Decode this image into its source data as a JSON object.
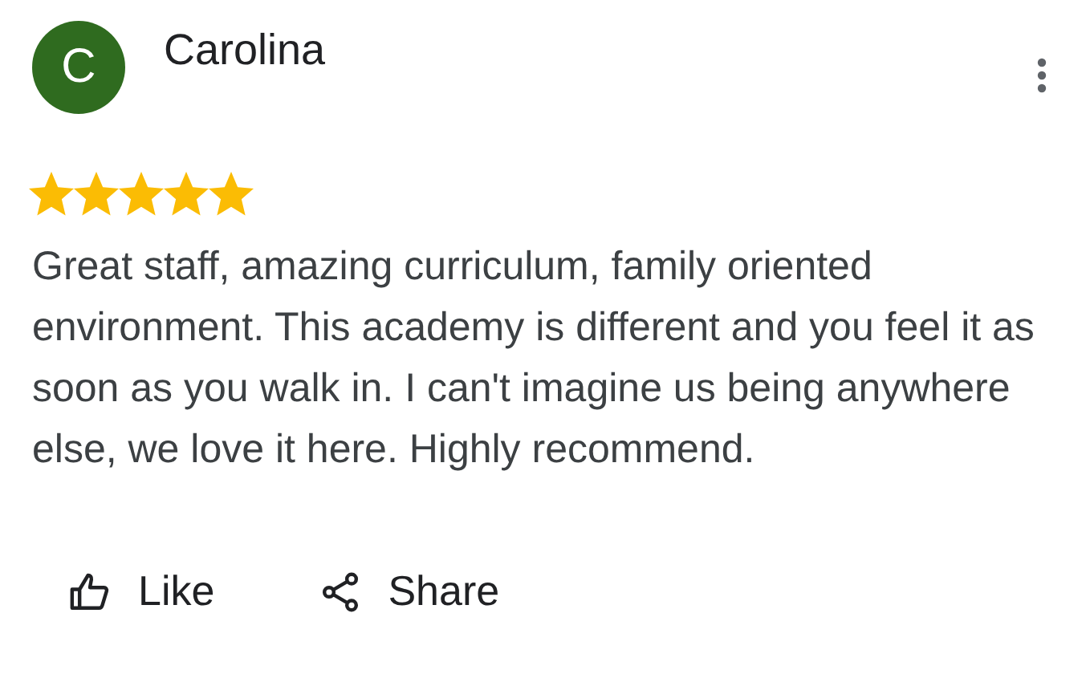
{
  "review": {
    "avatar_letter": "C",
    "author": "Carolina",
    "stars": 5,
    "text": "Great staff, amazing curriculum, family oriented environment. This academy is different and you feel it as soon as you walk in. I can't imagine us being anywhere else, we love it here. Highly recommend."
  },
  "actions": [
    {
      "kind": "like",
      "label": "Like"
    },
    {
      "kind": "share",
      "label": "Share"
    }
  ]
}
